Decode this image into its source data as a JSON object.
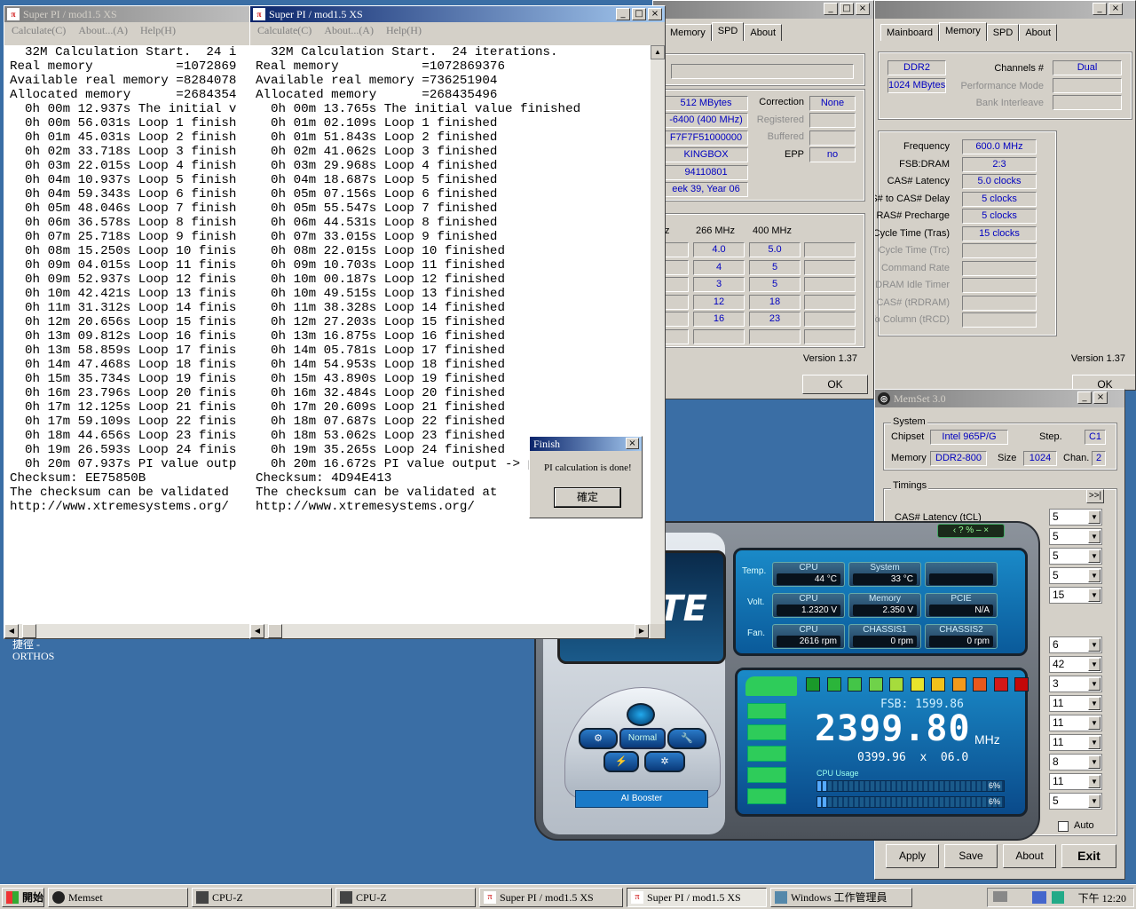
{
  "desktop": {
    "shortcut_label_top": "捷徑 -",
    "shortcut_label_bottom": "ORTHOS"
  },
  "superpi1": {
    "title": "Super PI / mod1.5 XS",
    "menu": [
      "Calculate(C)",
      "About...(A)",
      "Help(H)"
    ],
    "lines": [
      "  32M Calculation Start.  24 i",
      "Real memory           =1072869",
      "Available real memory =8284078",
      "Allocated memory      =2684354",
      "  0h 00m 12.937s The initial v",
      "  0h 00m 56.031s Loop 1 finish",
      "  0h 01m 45.031s Loop 2 finish",
      "  0h 02m 33.718s Loop 3 finish",
      "  0h 03m 22.015s Loop 4 finish",
      "  0h 04m 10.937s Loop 5 finish",
      "  0h 04m 59.343s Loop 6 finish",
      "  0h 05m 48.046s Loop 7 finish",
      "  0h 06m 36.578s Loop 8 finish",
      "  0h 07m 25.718s Loop 9 finish",
      "  0h 08m 15.250s Loop 10 finis",
      "  0h 09m 04.015s Loop 11 finis",
      "  0h 09m 52.937s Loop 12 finis",
      "  0h 10m 42.421s Loop 13 finis",
      "  0h 11m 31.312s Loop 14 finis",
      "  0h 12m 20.656s Loop 15 finis",
      "  0h 13m 09.812s Loop 16 finis",
      "  0h 13m 58.859s Loop 17 finis",
      "  0h 14m 47.468s Loop 18 finis",
      "  0h 15m 35.734s Loop 19 finis",
      "  0h 16m 23.796s Loop 20 finis",
      "  0h 17m 12.125s Loop 21 finis",
      "  0h 17m 59.109s Loop 22 finis",
      "  0h 18m 44.656s Loop 23 finis",
      "  0h 19m 26.593s Loop 24 finis",
      "  0h 20m 07.937s PI value outp",
      "",
      "Checksum: EE75850B",
      "The checksum can be validated",
      "http://www.xtremesystems.org/"
    ]
  },
  "superpi2": {
    "title": "Super PI / mod1.5 XS",
    "menu": [
      "Calculate(C)",
      "About...(A)",
      "Help(H)"
    ],
    "lines": [
      "  32M Calculation Start.  24 iterations.",
      "Real memory           =1072869376",
      "Available real memory =736251904",
      "Allocated memory      =268435496",
      "  0h 00m 13.765s The initial value finished",
      "  0h 01m 02.109s Loop 1 finished",
      "  0h 01m 51.843s Loop 2 finished",
      "  0h 02m 41.062s Loop 3 finished",
      "  0h 03m 29.968s Loop 4 finished",
      "  0h 04m 18.687s Loop 5 finished",
      "  0h 05m 07.156s Loop 6 finished",
      "  0h 05m 55.547s Loop 7 finished",
      "  0h 06m 44.531s Loop 8 finished",
      "  0h 07m 33.015s Loop 9 finished",
      "  0h 08m 22.015s Loop 10 finished",
      "  0h 09m 10.703s Loop 11 finished",
      "  0h 10m 00.187s Loop 12 finished",
      "  0h 10m 49.515s Loop 13 finished",
      "  0h 11m 38.328s Loop 14 finished",
      "  0h 12m 27.203s Loop 15 finished",
      "  0h 13m 16.875s Loop 16 finished",
      "  0h 14m 05.781s Loop 17 finished",
      "  0h 14m 54.953s Loop 18 finished",
      "  0h 15m 43.890s Loop 19 finished",
      "  0h 16m 32.484s Loop 20 finished",
      "  0h 17m 20.609s Loop 21 finished",
      "  0h 18m 07.687s Loop 22 finished",
      "  0h 18m 53.062s Loop 23 finished",
      "  0h 19m 35.265s Loop 24 finished",
      "  0h 20m 16.672s PI value output -> pi_data.txt",
      "",
      "Checksum: 4D94E413",
      "The checksum can be validated at",
      "http://www.xtremesystems.org/"
    ]
  },
  "finish_dialog": {
    "title": "Finish",
    "message": "PI calculation is done!",
    "ok": "確定"
  },
  "cpuz_spd": {
    "tabs": [
      "Memory",
      "SPD",
      "About"
    ],
    "selected_tab": "SPD",
    "left_values": [
      "512 MBytes",
      "-6400 (400 MHz)",
      "F7F7F51000000",
      "KINGBOX",
      "94110801",
      "eek 39, Year 06"
    ],
    "right_labels": [
      "Correction",
      "Registered",
      "Buffered",
      "EPP"
    ],
    "right_values": [
      "None",
      "",
      "",
      "no"
    ],
    "timing_header": [
      "Hz",
      "266 MHz",
      "400 MHz"
    ],
    "timing_rows": [
      [
        "",
        "4.0",
        "5.0"
      ],
      [
        "",
        "4",
        "5"
      ],
      [
        "",
        "3",
        "5"
      ],
      [
        "",
        "12",
        "18"
      ],
      [
        "",
        "16",
        "23"
      ],
      [
        "",
        "",
        ""
      ]
    ],
    "version": "Version 1.37",
    "ok": "OK"
  },
  "cpuz_mem": {
    "tabs": [
      "Mainboard",
      "Memory",
      "SPD",
      "About"
    ],
    "selected_tab": "Memory",
    "type": "DDR2",
    "size": "1024 MBytes",
    "channels_label": "Channels #",
    "channels": "Dual",
    "perf_mode_label": "Performance Mode",
    "bank_label": "Bank Interleave",
    "timings": [
      {
        "label": "Frequency",
        "value": "600.0 MHz",
        "dis": false
      },
      {
        "label": "FSB:DRAM",
        "value": "2:3",
        "dis": false
      },
      {
        "label": "CAS# Latency",
        "value": "5.0 clocks",
        "dis": false
      },
      {
        "label": "S# to CAS# Delay",
        "value": "5 clocks",
        "dis": false
      },
      {
        "label": "RAS# Precharge",
        "value": "5 clocks",
        "dis": false
      },
      {
        "label": "Cycle Time (Tras)",
        "value": "15 clocks",
        "dis": false
      },
      {
        "label": "Cycle Time (Trc)",
        "value": "",
        "dis": true
      },
      {
        "label": "Command Rate",
        "value": "",
        "dis": true
      },
      {
        "label": "DRAM Idle Timer",
        "value": "",
        "dis": true
      },
      {
        "label": "CAS# (tRDRAM)",
        "value": "",
        "dis": true
      },
      {
        "label": "To Column (tRCD)",
        "value": "",
        "dis": true
      }
    ],
    "version": "Version 1.37",
    "ok": "OK"
  },
  "memset": {
    "title": "MemSet 3.0",
    "system_label": "System",
    "chipset_label": "Chipset",
    "chipset": "Intel 965P/G",
    "step_label": "Step.",
    "step": "C1",
    "memory_label": "Memory",
    "memory": "DDR2-800",
    "size_label": "Size",
    "size": "1024",
    "chan_label": "Chan.",
    "chan": "2",
    "timings_label": "Timings",
    "cas_label": "CAS# Latency (tCL)",
    "expand": ">>|",
    "selects_top": [
      "5",
      "5",
      "5",
      "5",
      "15"
    ],
    "selects_bottom": [
      "6",
      "42",
      "3",
      "11",
      "11",
      "11",
      "8",
      "11",
      "5"
    ],
    "auto_label": "Auto",
    "buttons": [
      "Apply",
      "Save",
      "About",
      "Exit"
    ]
  },
  "ai_booster": {
    "logo_text": "TE",
    "temp_label": "Temp.",
    "volt_label": "Volt.",
    "fan_label": "Fan.",
    "sensors": [
      {
        "name": "CPU",
        "value": "44 °C"
      },
      {
        "name": "System",
        "value": "33 °C"
      },
      {
        "name": "",
        "value": ""
      },
      {
        "name": "CPU",
        "value": "1.2320 V"
      },
      {
        "name": "Memory",
        "value": "2.350 V"
      },
      {
        "name": "PCIE",
        "value": "N/A"
      },
      {
        "name": "CPU",
        "value": "2616 rpm"
      },
      {
        "name": "CHASSIS1",
        "value": "0 rpm"
      },
      {
        "name": "CHASSIS2",
        "value": "0 rpm"
      }
    ],
    "fsb": "FSB: 1599.86",
    "freq": "2399.80",
    "freq_unit": "MHz",
    "multi": "0399.96  x  06.0",
    "cpu_usage_label": "CPU Usage",
    "usage": [
      "6%",
      "6%"
    ],
    "mode": "Normal",
    "booster_label": "AI Booster",
    "led_colors": [
      "#1a9a2a",
      "#2bb53a",
      "#44c548",
      "#6fd24a",
      "#a6dc3c",
      "#e8e42c",
      "#f2c21c",
      "#f29a1c",
      "#e8581c",
      "#d41818",
      "#c40808"
    ]
  },
  "taskbar": {
    "start": "開始",
    "items": [
      "Memset",
      "CPU-Z",
      "CPU-Z",
      "Super PI / mod1.5 XS",
      "Super PI / mod1.5 XS",
      "Windows 工作管理員"
    ],
    "clock": "下午 12:20"
  }
}
